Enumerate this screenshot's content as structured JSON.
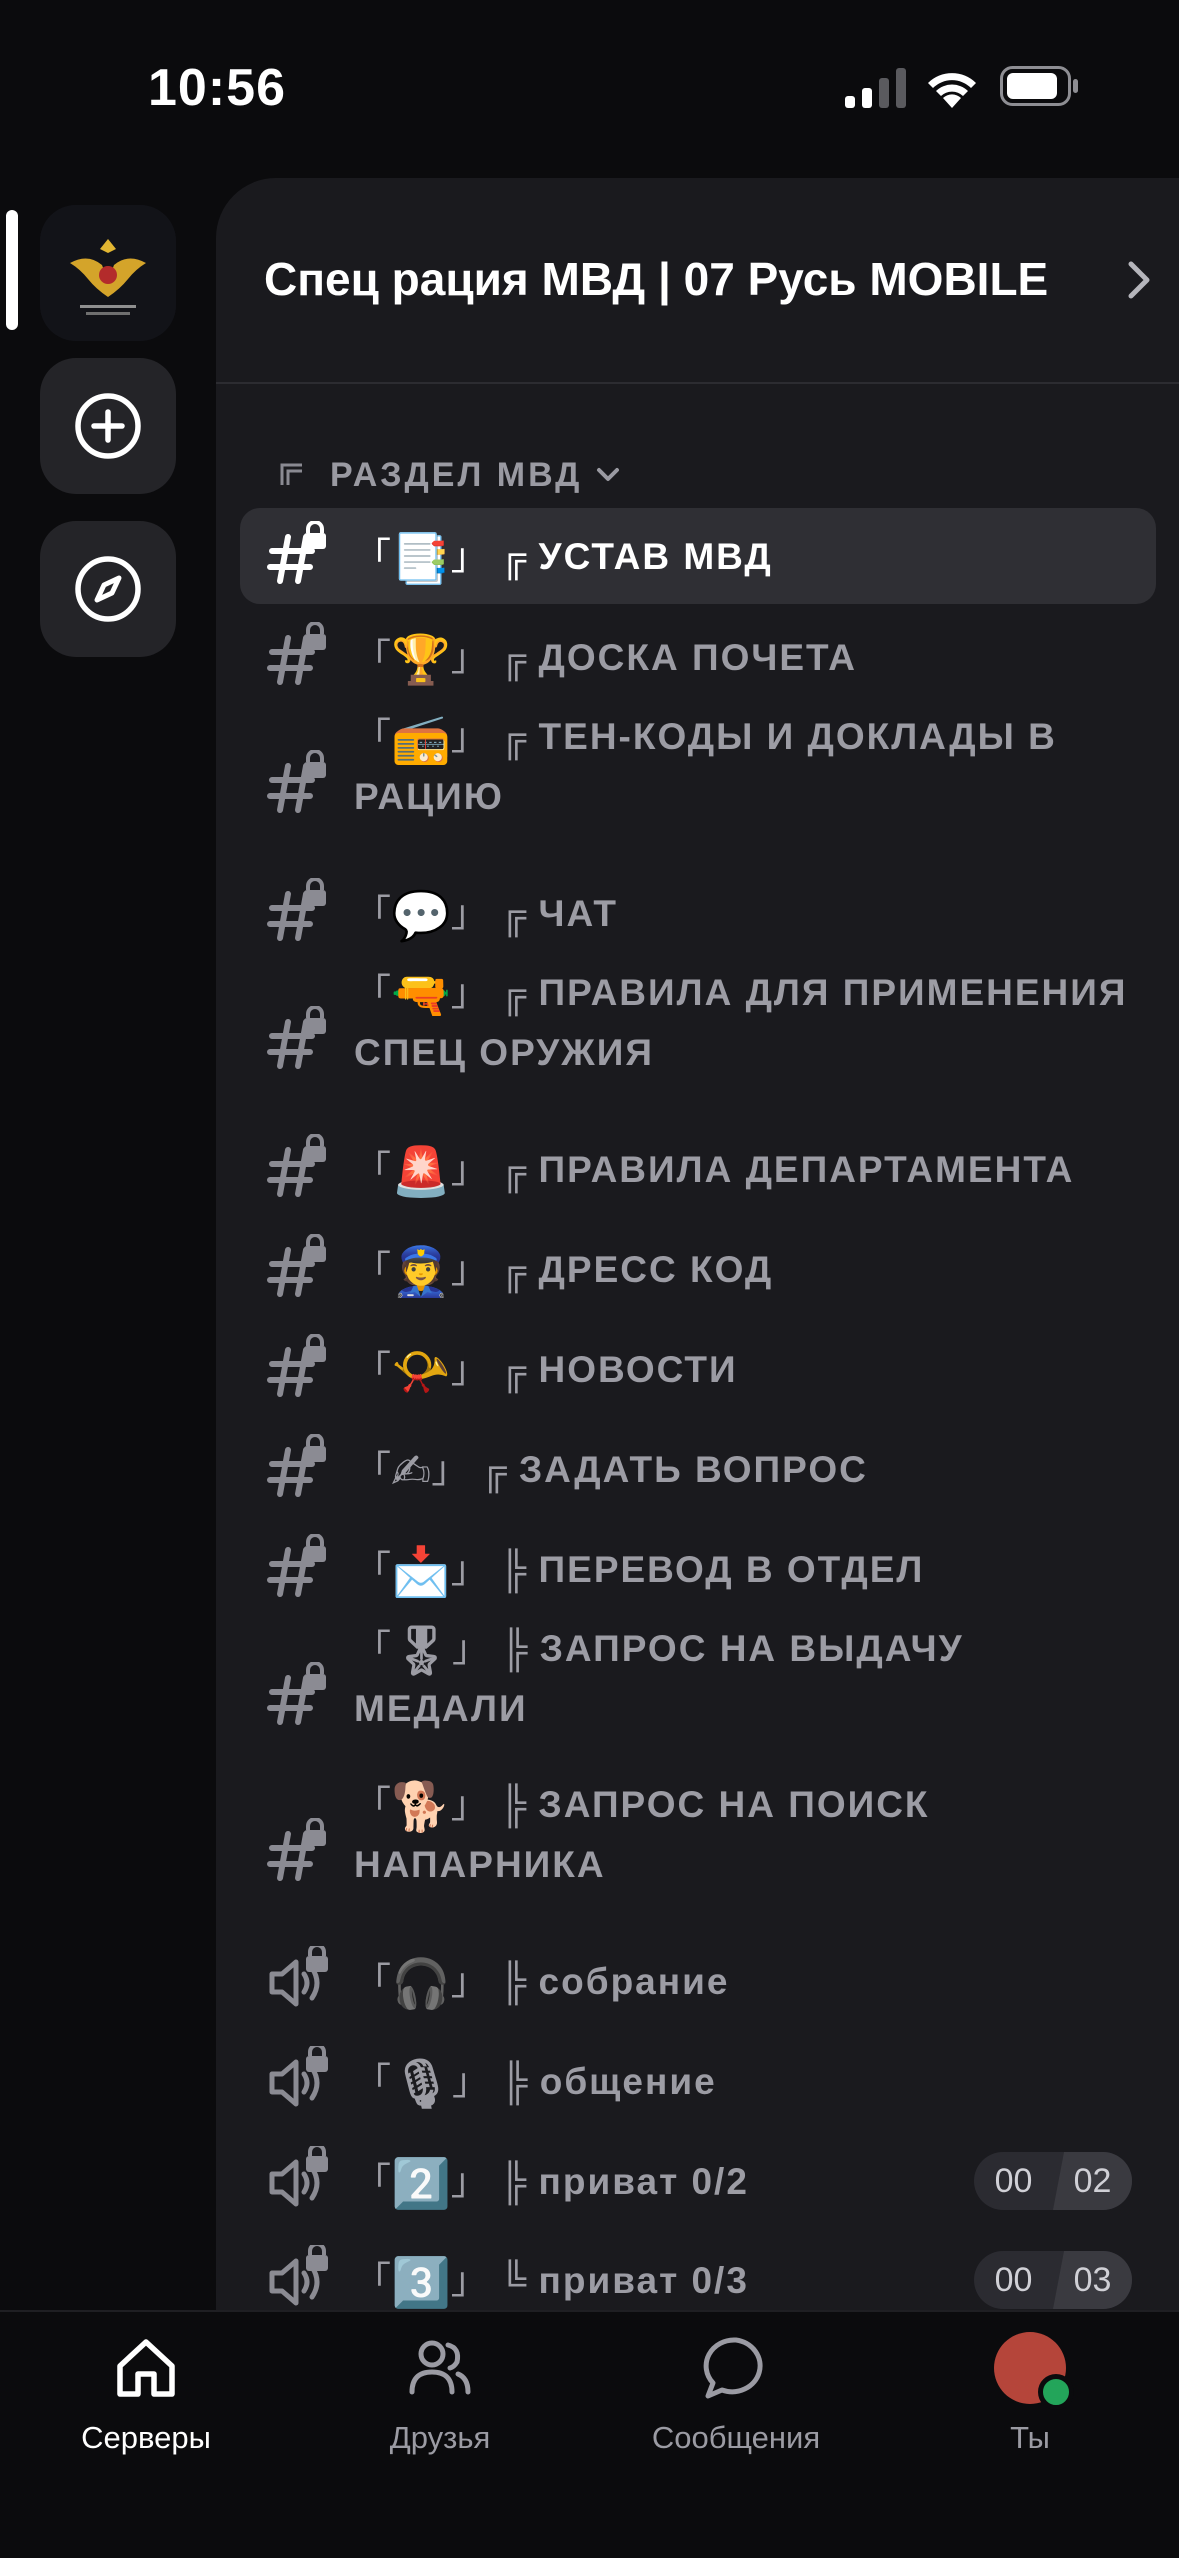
{
  "status_bar": {
    "time": "10:56"
  },
  "server_rail": {
    "servers": [
      {
        "name": "MVD server icon",
        "icon": "emblem-icon"
      },
      {
        "name": "Add server",
        "icon": "plus-circle-icon"
      },
      {
        "name": "Explore",
        "icon": "compass-icon"
      }
    ]
  },
  "guild": {
    "name": "Спец рация МВД | 07 Русь MOBILE"
  },
  "category": {
    "label": "РАЗДЕЛ МВД"
  },
  "channels": [
    {
      "type": "text",
      "emoji": "📑",
      "sep": "╔",
      "name": "УСТАВ МВД",
      "active": true
    },
    {
      "type": "text",
      "emoji": "🏆",
      "sep": "╔",
      "name": "ДОСКА ПОЧЕТА"
    },
    {
      "type": "text",
      "emoji": "📻",
      "sep": "╔",
      "name": "ТЕН-КОДЫ И ДОКЛАДЫ В РАЦИЮ"
    },
    {
      "type": "text",
      "emoji": "💬",
      "sep": "╔",
      "name": "ЧАТ"
    },
    {
      "type": "text",
      "emoji": "🔫",
      "sep": "╔",
      "name": "ПРАВИЛА ДЛЯ ПРИМЕНЕНИЯ СПЕЦ ОРУЖИЯ"
    },
    {
      "type": "text",
      "emoji": "🚨",
      "sep": "╔",
      "name": "ПРАВИЛА ДЕПАРТАМЕНТА"
    },
    {
      "type": "text",
      "emoji": "👮",
      "sep": "╔",
      "name": "ДРЕСС КОД"
    },
    {
      "type": "text",
      "emoji": "📯",
      "sep": "╔",
      "name": "НОВОСТИ"
    },
    {
      "type": "text",
      "emoji": "✍",
      "sep": "╔",
      "name": "ЗАДАТЬ ВОПРОС"
    },
    {
      "type": "text",
      "emoji": "📩",
      "sep": "╠",
      "name": "ПЕРЕВОД В ОТДЕЛ"
    },
    {
      "type": "text",
      "emoji": "🎖",
      "sep": "╠",
      "name": "ЗАПРОС НА ВЫДАЧУ МЕДАЛИ"
    },
    {
      "type": "text",
      "emoji": "🐕",
      "sep": "╠",
      "name": "ЗАПРОС НА ПОИСК НАПАРНИКА"
    },
    {
      "type": "voice",
      "emoji": "🎧",
      "sep": "╠",
      "name": "собрание"
    },
    {
      "type": "voice",
      "emoji": "🎙",
      "sep": "╠",
      "name": "общение"
    },
    {
      "type": "voice",
      "emoji": "2️⃣",
      "sep": "╠",
      "name": "приват 0/2",
      "badge": {
        "left": "00",
        "right": "02"
      }
    },
    {
      "type": "voice",
      "emoji": "3️⃣",
      "sep": "╚",
      "name": "приват 0/3",
      "badge": {
        "left": "00",
        "right": "03"
      }
    }
  ],
  "tabs": [
    {
      "label": "Серверы",
      "icon": "home-icon",
      "active": true
    },
    {
      "label": "Друзья",
      "icon": "friends-icon"
    },
    {
      "label": "Сообщения",
      "icon": "chat-bubble-icon"
    },
    {
      "label": "Ты",
      "icon": "avatar"
    }
  ]
}
